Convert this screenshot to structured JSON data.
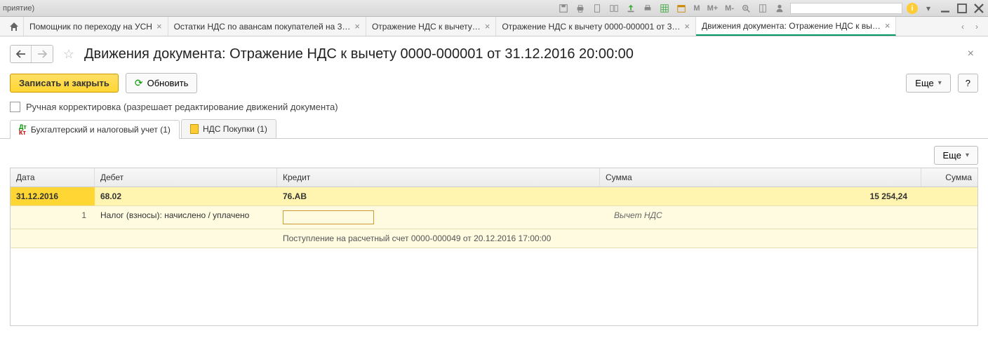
{
  "window": {
    "title_fragment": "приятие)"
  },
  "toolbar": {
    "m_buttons": [
      "M",
      "M+",
      "M-"
    ]
  },
  "tabs": [
    {
      "label": "Помощник по переходу на УСН",
      "active": false
    },
    {
      "label": "Остатки НДС по авансам покупателей на 3…",
      "active": false
    },
    {
      "label": "Отражение НДС к вычету…",
      "active": false
    },
    {
      "label": "Отражение НДС к вычету 0000-000001 от 3…",
      "active": false
    },
    {
      "label": "Движения документа: Отражение НДС к вы…",
      "active": true
    }
  ],
  "page": {
    "title": "Движения документа: Отражение НДС к вычету 0000-000001 от 31.12.2016 20:00:00"
  },
  "actions": {
    "save_close": "Записать и закрыть",
    "refresh": "Обновить",
    "more": "Еще",
    "help": "?"
  },
  "checkbox_row": {
    "label": "Ручная корректировка (разрешает редактирование движений документа)"
  },
  "subtabs": [
    {
      "label": "Бухгалтерский и налоговый учет (1)",
      "active": true,
      "icon": "dtkt"
    },
    {
      "label": "НДС Покупки (1)",
      "active": false,
      "icon": "doc"
    }
  ],
  "grid": {
    "more": "Еще",
    "headers": {
      "date": "Дата",
      "debit": "Дебет",
      "credit": "Кредит",
      "sum": "Сумма",
      "sum2": "Сумма"
    },
    "row1": {
      "date": "31.12.2016",
      "debit": "68.02",
      "credit": "76.АВ",
      "sum": "15 254,24"
    },
    "row2": {
      "num": "1",
      "debit_text": "Налог (взносы): начислено / уплачено",
      "credit_sub": "Поступление на расчетный счет 0000-000049 от 20.12.2016 17:00:00",
      "sum_text": "Вычет НДС"
    }
  }
}
